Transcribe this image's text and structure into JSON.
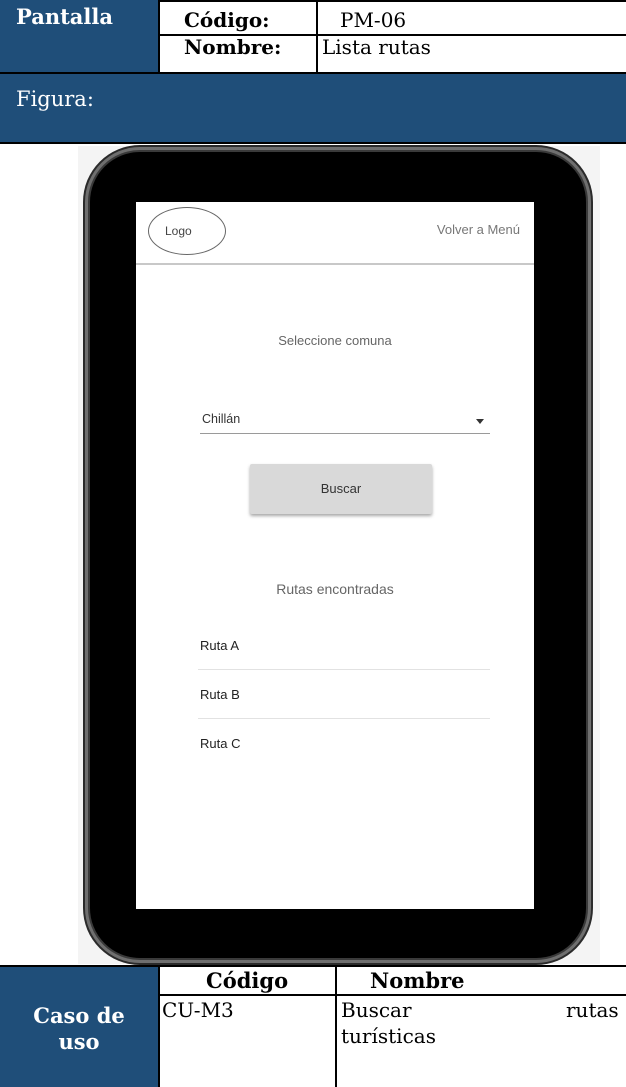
{
  "header": {
    "pantalla_label": "Pantalla",
    "codigo_label": "Código:",
    "codigo_value": "PM-06",
    "nombre_label": "Nombre:",
    "nombre_value": "Lista rutas"
  },
  "figura_label": "Figura:",
  "mockup": {
    "logo": "Logo",
    "back_link": "Volver a Menú",
    "select_title": "Seleccione comuna",
    "dropdown_value": "Chillán",
    "search_button": "Buscar",
    "results_title": "Rutas encontradas",
    "routes": [
      "Ruta A",
      "Ruta B",
      "Ruta C"
    ]
  },
  "use_case": {
    "label_line1": "Caso de",
    "label_line2": "uso",
    "codigo_header": "Código",
    "nombre_header": "Nombre",
    "codigo_value": "CU-M3",
    "nombre_word1": "Buscar",
    "nombre_word2": "rutas",
    "nombre_line2": "turísticas"
  },
  "colors": {
    "header_bg": "#1f4e79",
    "button_bg": "#d9d9d9"
  }
}
